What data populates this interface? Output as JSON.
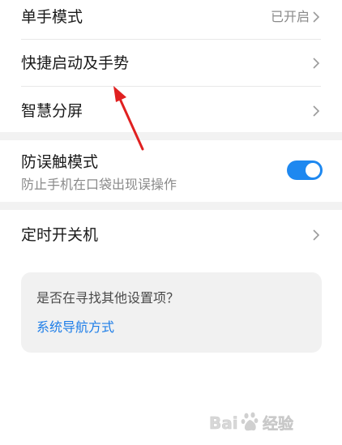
{
  "settings": {
    "one_hand": {
      "title": "单手模式",
      "value": "已开启"
    },
    "quick_launch": {
      "title": "快捷启动及手势"
    },
    "split_screen": {
      "title": "智慧分屏"
    },
    "accidental_touch": {
      "title": "防误触模式",
      "subtitle": "防止手机在口袋出现误操作",
      "enabled": true
    },
    "scheduled_power": {
      "title": "定时开关机"
    }
  },
  "suggestion_card": {
    "question": "是否在寻找其他设置项？",
    "link": "系统导航方式"
  },
  "colors": {
    "accent": "#1e88f0",
    "annotation": "#e02020"
  },
  "watermark": {
    "text": "Baidu经验",
    "icon": "baidu-paw-icon"
  }
}
